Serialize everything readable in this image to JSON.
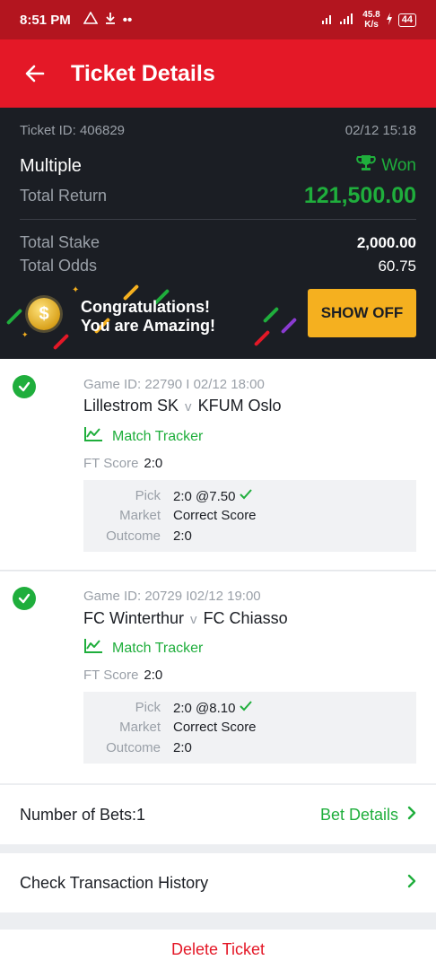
{
  "status_bar": {
    "time": "8:51 PM",
    "net_speed_value": "45.8",
    "net_speed_unit": "K/s",
    "battery": "44"
  },
  "header": {
    "title": "Ticket Details"
  },
  "summary": {
    "ticket_id": "Ticket ID: 406829",
    "date": "02/12 15:18",
    "bet_type": "Multiple",
    "result": "Won",
    "total_return_label": "Total Return",
    "total_return_value": "121,500.00",
    "total_stake_label": "Total Stake",
    "total_stake_value": "2,000.00",
    "total_odds_label": "Total Odds",
    "total_odds_value": "60.75"
  },
  "banner": {
    "line1": "Congratulations!",
    "line2": "You are Amazing!",
    "button": "SHOW OFF",
    "coin_symbol": "$"
  },
  "bets": [
    {
      "game_id": "Game ID: 22790 I 02/12 18:00",
      "home": "Lillestrom SK",
      "vs": "v",
      "away": "KFUM Oslo",
      "tracker": "Match Tracker",
      "ft_label": "FT Score",
      "ft_value": "2:0",
      "pick_label": "Pick",
      "pick_value": "2:0 @7.50",
      "market_label": "Market",
      "market_value": "Correct Score",
      "outcome_label": "Outcome",
      "outcome_value": "2:0"
    },
    {
      "game_id": "Game ID: 20729 I02/12 19:00",
      "home": "FC Winterthur",
      "vs": "v",
      "away": "FC Chiasso",
      "tracker": "Match Tracker",
      "ft_label": "FT Score",
      "ft_value": "2:0",
      "pick_label": "Pick",
      "pick_value": "2:0 @8.10",
      "market_label": "Market",
      "market_value": "Correct Score",
      "outcome_label": "Outcome",
      "outcome_value": "2:0"
    }
  ],
  "footer": {
    "num_bets": "Number of Bets:1",
    "bet_details": "Bet Details",
    "transaction_history": "Check Transaction History",
    "delete": "Delete Ticket"
  },
  "colors": {
    "brand_red": "#e41827",
    "win_green": "#1fae3c",
    "dark_bg": "#1b1e24",
    "accent_yellow": "#f5b01f"
  }
}
